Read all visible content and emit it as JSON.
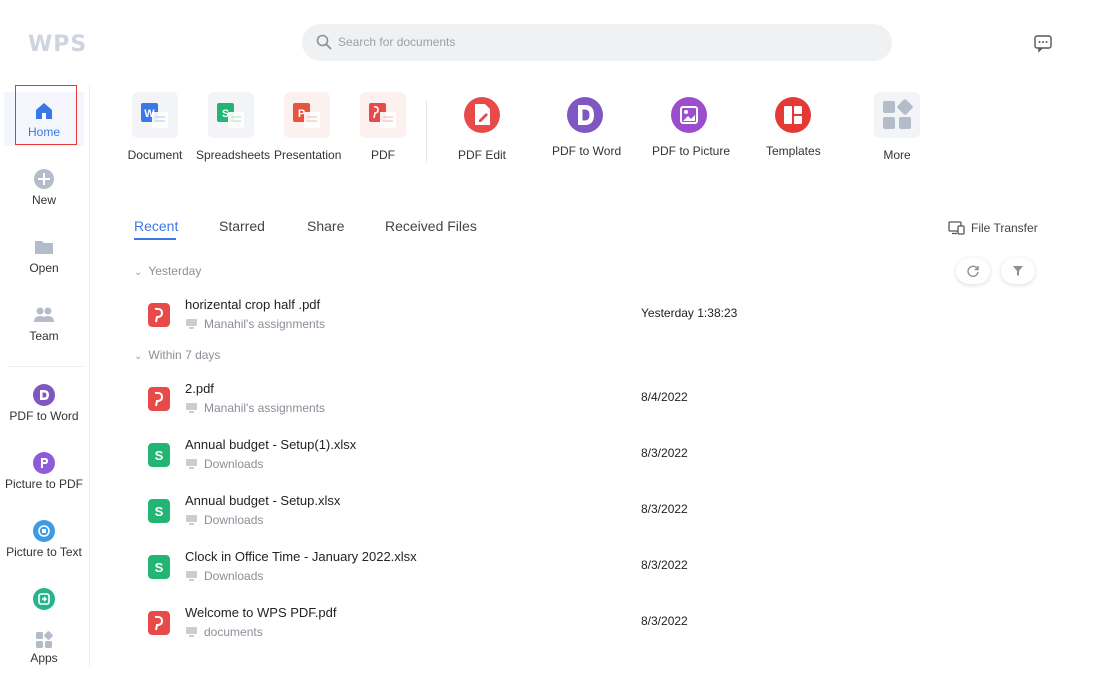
{
  "app": {
    "logo": "WPS"
  },
  "search": {
    "placeholder": "Search for documents"
  },
  "sidebar": {
    "items": [
      {
        "label": "Home",
        "icon": "home-icon",
        "color": "#3b78e7"
      },
      {
        "label": "New",
        "icon": "plus-icon",
        "color": "#b5bcc9"
      },
      {
        "label": "Open",
        "icon": "folder-icon",
        "color": "#b5bcc9"
      },
      {
        "label": "Team",
        "icon": "team-icon",
        "color": "#b5bcc9"
      },
      {
        "label": "PDF to Word",
        "icon": "pdf-to-word-icon",
        "color": "#7e57c2"
      },
      {
        "label": "Picture to PDF",
        "icon": "picture-to-pdf-icon",
        "color": "#8e5cd6"
      },
      {
        "label": "Picture to Text",
        "icon": "picture-to-text-icon",
        "color": "#3b9be7"
      },
      {
        "label": "",
        "icon": "convert-icon",
        "color": "#26b58e"
      },
      {
        "label": "Apps",
        "icon": "apps-icon",
        "color": "#b5bcc9"
      }
    ]
  },
  "quick": [
    {
      "label": "Document",
      "icon": "word-doc-icon",
      "letter": "W",
      "color": "#3b78e7"
    },
    {
      "label": "Spreadsheets",
      "icon": "spreadsheet-icon",
      "letter": "S",
      "color": "#22b573"
    },
    {
      "label": "Presentation",
      "icon": "presentation-icon",
      "letter": "P",
      "color": "#e8553e"
    },
    {
      "label": "PDF",
      "icon": "pdf-icon",
      "letter": "P",
      "color": "#e84a4a"
    },
    {
      "label": "PDF Edit",
      "icon": "pdf-edit-icon",
      "color": "#e84a4a"
    },
    {
      "label": "PDF to Word",
      "icon": "pdf-to-word-icon",
      "color": "#7e57c2"
    },
    {
      "label": "PDF to Picture",
      "icon": "pdf-to-picture-icon",
      "color": "#9c4dcc"
    },
    {
      "label": "Templates",
      "icon": "templates-icon",
      "color": "#e53935"
    },
    {
      "label": "More",
      "icon": "more-apps-icon",
      "color": "#b5bcc9"
    }
  ],
  "tabs": [
    "Recent",
    "Starred",
    "Share",
    "Received Files"
  ],
  "file_transfer": "File Transfer",
  "groups": [
    "Yesterday",
    "Within 7 days"
  ],
  "files": [
    {
      "name": "horizental crop half .pdf",
      "location": "Manahil's assignments",
      "date": "Yesterday 1:38:23",
      "type": "pdf",
      "color": "#e84a4a"
    },
    {
      "name": "2.pdf",
      "location": "Manahil's assignments",
      "date": "8/4/2022",
      "type": "pdf",
      "color": "#e84a4a"
    },
    {
      "name": "Annual budget - Setup(1).xlsx",
      "location": "Downloads",
      "date": "8/3/2022",
      "type": "xlsx",
      "color": "#22b573"
    },
    {
      "name": "Annual budget - Setup.xlsx",
      "location": "Downloads",
      "date": "8/3/2022",
      "type": "xlsx",
      "color": "#22b573"
    },
    {
      "name": "Clock in Office Time - January 2022.xlsx",
      "location": "Downloads",
      "date": "8/3/2022",
      "type": "xlsx",
      "color": "#22b573"
    },
    {
      "name": "Welcome to WPS PDF.pdf",
      "location": "documents",
      "date": "8/3/2022",
      "type": "pdf",
      "color": "#e84a4a"
    }
  ]
}
